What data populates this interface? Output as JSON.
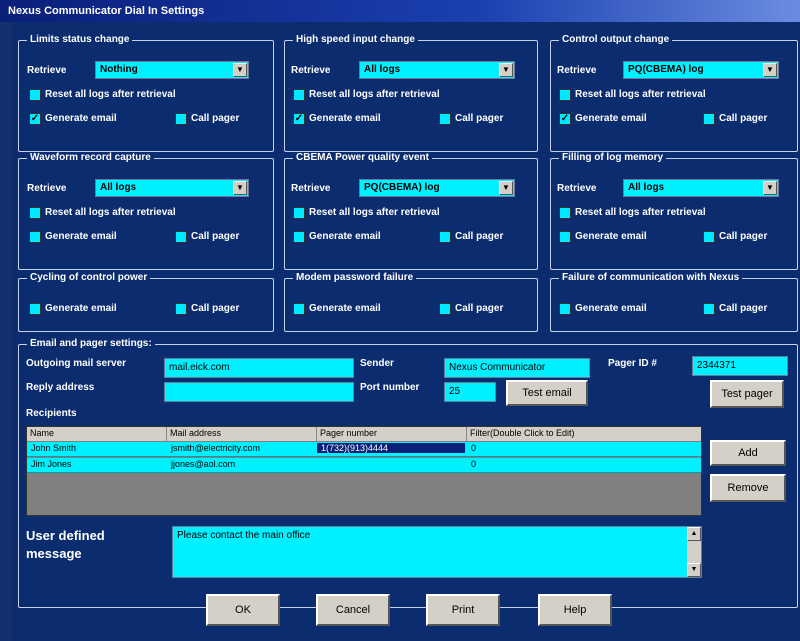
{
  "window": {
    "title": "Nexus Communicator Dial In Settings"
  },
  "common": {
    "retrieve_label": "Retrieve",
    "reset_label": "Reset all logs after retrieval",
    "email_label": "Generate email",
    "pager_label": "Call pager",
    "dropdown_arrow": "▼",
    "check_mark": "✓"
  },
  "groups": [
    {
      "title": "Limits status change",
      "retrieve": "Nothing",
      "email_checked": true
    },
    {
      "title": "High speed input change",
      "retrieve": "All logs",
      "email_checked": true
    },
    {
      "title": "Control output change",
      "retrieve": "PQ(CBEMA) log",
      "email_checked": true
    },
    {
      "title": "Waveform record capture",
      "retrieve": "All logs",
      "email_checked": false
    },
    {
      "title": "CBEMA Power quality event",
      "retrieve": "PQ(CBEMA) log",
      "email_checked": false
    },
    {
      "title": "Filling of log memory",
      "retrieve": "All logs",
      "email_checked": false
    },
    {
      "title": "Cycling of control power"
    },
    {
      "title": "Modem password failure"
    },
    {
      "title": "Failure of communication with Nexus"
    }
  ],
  "email_settings": {
    "title": "Email and pager settings:",
    "outgoing_label": "Outgoing mail server",
    "outgoing_value": "mail.eick.com",
    "sender_label": "Sender",
    "sender_value": "Nexus Communicator",
    "pager_id_label": "Pager ID #",
    "pager_id_value": "2344371",
    "reply_label": "Reply address",
    "reply_value": "",
    "port_label": "Port number",
    "port_value": "25",
    "test_email": "Test email",
    "test_pager": "Test pager",
    "recipients_label": "Recipients",
    "columns": [
      "Name",
      "Mail address",
      "Pager number",
      "Filter(Double Click to Edit)"
    ],
    "rows": [
      {
        "name": "John Smith",
        "mail": "jsmith@electricity.com",
        "pager": "1(732)(913)4444",
        "filter": "0"
      },
      {
        "name": "Jim Jones",
        "mail": "jjones@aol.com",
        "pager": "",
        "filter": "0"
      }
    ],
    "add": "Add",
    "remove": "Remove",
    "user_msg_label_1": "User defined",
    "user_msg_label_2": "message",
    "user_msg_value": "Please contact the main office"
  },
  "footer": {
    "ok": "OK",
    "cancel": "Cancel",
    "print": "Print",
    "help": "Help"
  }
}
